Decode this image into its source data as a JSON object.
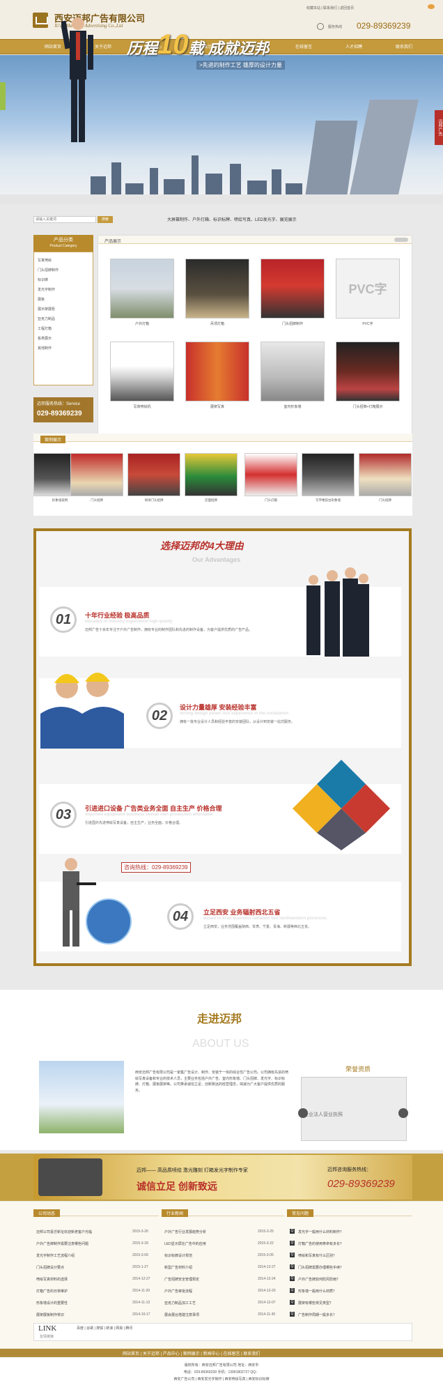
{
  "header": {
    "company_cn": "西安迈邦广告有限公司",
    "company_en": "Xi'an Maibang Advertising Co.,Ltd",
    "top_links": "收藏本站 | 联系我们 | 返回首页",
    "tel_label": "服务热线",
    "tel_number": "029-89369239"
  },
  "nav": [
    "网站首页",
    "关于迈邦",
    "产品中心",
    "案例展示",
    "新闻中心",
    "在线留言",
    "人才招聘",
    "联系我们"
  ],
  "banner": {
    "slogan_pre": "历程",
    "slogan_num": "10",
    "slogan_post": "载 成就迈邦",
    "sub": ">先进的制作工艺 雄厚的设计力量",
    "side_tag": "迈邦广告"
  },
  "search": {
    "placeholder": "请输入关键词",
    "button": "搜索",
    "marquee": "大屏幕制作、户外灯箱、标识标牌、喷绘写真、LED发光字、展览展示"
  },
  "sidebar": {
    "title": "产品分类",
    "title_en": "Product Category",
    "items": [
      "写真喷绘",
      "门头招牌制作",
      "标识牌",
      "发光字制作",
      "展板",
      "展示架展柜",
      "亚克力制品",
      "工程灯箱",
      "各类展示",
      "其他制作"
    ],
    "hotline_label": "迈邦服务热线：Service",
    "hotline_number": "029-89369239"
  },
  "products": {
    "title": "产品展示",
    "items": [
      {
        "caption": "户外灯箱"
      },
      {
        "caption": "吊顶灯箱"
      },
      {
        "caption": "门头招牌制作"
      },
      {
        "caption": "PVC字"
      },
      {
        "caption": "写真喷绘机"
      },
      {
        "caption": "展架写真"
      },
      {
        "caption": "室内形象墙"
      },
      {
        "caption": "门头招牌+灯箱展示"
      }
    ]
  },
  "cases": {
    "title": "案例展示",
    "items": [
      {
        "caption": "形象墙案例"
      },
      {
        "caption": "门头招牌"
      },
      {
        "caption": "商场门头招牌"
      },
      {
        "caption": "店面招牌"
      },
      {
        "caption": "门头灯箱"
      },
      {
        "caption": "写字楼前台形象墙"
      },
      {
        "caption": "门头招牌"
      }
    ]
  },
  "advantages": {
    "title": "选择迈邦的4大理由",
    "title_en": "Our Advantages",
    "phone": "咨询热线：029-89369239",
    "items": [
      {
        "num": "01",
        "title": "十年行业经验  极高品质",
        "en": "Decades of industry experience high quality",
        "text": "迈邦广告十余年专注于户外广告制作，拥有专业的制作团队和先进的制作设备，为客户提供优质的广告产品。"
      },
      {
        "num": "02",
        "title": "设计力量雄厚  安装经验丰富",
        "en": "Strong design power rich experience in the installation",
        "text": "拥有一批专业设计人员和经验丰富的安装团队，从设计到安装一站式服务。"
      },
      {
        "num": "03",
        "title": "引进进口设备  广告类业务全面  自主生产  价格合理",
        "en": "Imported equipment business overall own production affordable",
        "text": "引进国外先进喷绘写真设备，自主生产，业务全面，价格合理。"
      },
      {
        "num": "04",
        "title": "立足西安  业务辐射西北五省",
        "en": "Based in Xi'an business radiation five northwestern provinces",
        "text": "立足西安，业务范围覆盖陕西、甘肃、宁夏、青海、新疆等西北五省。"
      }
    ]
  },
  "about": {
    "title": "走进迈邦",
    "title_en": "ABOUT US",
    "text": "西安迈邦广告有限公司是一家集广告设计、制作、安装于一体的综合性广告公司。公司拥有先进的喷绘写真设备和专业的技术人员，主要业务包括户外广告、室内形象墙、门头招牌、发光字、标识标牌、灯箱、展板展架等。公司秉承诚信立足、创新致远的经营理念，竭诚为广大客户提供优质的服务。",
    "honor_title": "荣誉资质",
    "honor_caption": "企业法人营业执照"
  },
  "band": {
    "line1": "迈邦——  高品质喷绘 激光雕刻 灯箱发光字制作专家",
    "slogan": "诚信立足  创新致远",
    "hotline_label": "迈邦咨询服务热线：",
    "hotline": "029-89369239"
  },
  "news": {
    "company": {
      "title": "公司动态",
      "rows": [
        {
          "t": "迈邦公司喜迁新址欢迎新老客户光临",
          "d": "2015-3-20"
        },
        {
          "t": "户外广告牌制作需要注意哪些问题",
          "d": "2015-3-18"
        },
        {
          "t": "发光字制作工艺流程介绍",
          "d": "2015-3-09"
        },
        {
          "t": "门头招牌设计要点",
          "d": "2015-1-27"
        },
        {
          "t": "喷绘写真材料的选择",
          "d": "2014-12-27"
        },
        {
          "t": "灯箱广告的日常维护",
          "d": "2014-11-20"
        },
        {
          "t": "形象墙设计的重要性",
          "d": "2014-11-13"
        },
        {
          "t": "展架展板制作常识",
          "d": "2014-10-17"
        }
      ]
    },
    "industry": {
      "title": "行业新闻",
      "rows": [
        {
          "t": "户外广告行业发展趋势分析",
          "d": "2015-3-25"
        },
        {
          "t": "LED显示屏在广告中的应用",
          "d": "2015-3-22"
        },
        {
          "t": "标识标牌设计规范",
          "d": "2015-3-05"
        },
        {
          "t": "新型广告材料介绍",
          "d": "2014-12-27"
        },
        {
          "t": "广告招牌安全管理规定",
          "d": "2014-12-24"
        },
        {
          "t": "户外广告审批流程",
          "d": "2014-12-20"
        },
        {
          "t": "亚克力制品加工工艺",
          "d": "2014-12-07"
        },
        {
          "t": "展会展台搭建注意事项",
          "d": "2014-11-30"
        }
      ]
    },
    "faq": {
      "title": "常见问题",
      "rows": [
        {
          "t": "发光字一般用什么材料制作？"
        },
        {
          "t": "灯箱广告的使用寿命有多长？"
        },
        {
          "t": "喷绘和写真有什么区别？"
        },
        {
          "t": "门头招牌需要办理哪些手续？"
        },
        {
          "t": "户外广告牌如何防风防雨？"
        },
        {
          "t": "形象墙一般用什么材质？"
        },
        {
          "t": "展架有哪些常见类型？"
        },
        {
          "t": "广告制作周期一般多长？"
        }
      ]
    }
  },
  "link": {
    "title": "LINK",
    "sub": "友情链接",
    "text": "百度 | 谷歌 | 搜狐 | 新浪 | 网易 | 腾讯"
  },
  "footer": {
    "nav": "网站首页 | 关于迈邦 | 产品中心 | 案例展示 | 新闻中心 | 在线留言 | 联系我们",
    "line1": "版权所有：西安迈邦广告有限公司  地址：西安市",
    "line2": "电话：029-89369239  手机：13991802727  QQ：",
    "line3": "西安广告公司 | 西安发光字制作 | 西安喷绘写真 | 西安标识标牌"
  },
  "colors": {
    "brand_gold": "#b88a2c",
    "accent_red": "#b8302a"
  }
}
